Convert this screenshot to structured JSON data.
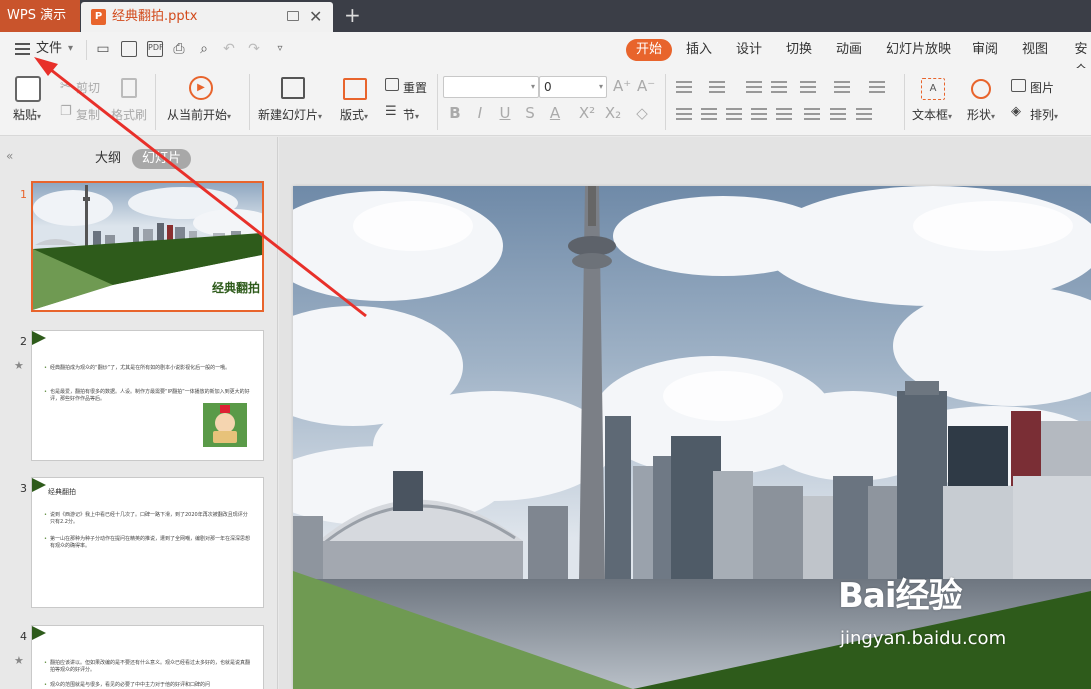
{
  "titlebar": {
    "app_label": "WPS 演示",
    "doc_tab": {
      "name": "经典翻拍.pptx",
      "icon": "P"
    },
    "new_tab_glyph": "+",
    "close_glyph": "✕"
  },
  "menubar": {
    "file_label": "文件",
    "tabs": [
      "开始",
      "插入",
      "设计",
      "切换",
      "动画",
      "幻灯片放映",
      "审阅",
      "视图",
      "安全"
    ],
    "active_tab": "开始"
  },
  "ribbon": {
    "paste": "粘贴",
    "cut": "剪切",
    "copy": "复制",
    "format_painter": "格式刷",
    "from_current": "从当前开始",
    "new_slide": "新建幻灯片",
    "layout": "版式",
    "reset": "重置",
    "section": "节",
    "font_size": "0",
    "textbox": "文本框",
    "shape": "形状",
    "picture": "图片",
    "arrange": "排列"
  },
  "leftpanel": {
    "tabs": [
      "大纲",
      "幻灯片"
    ],
    "active_tab": "幻灯片",
    "slides": [
      {
        "num": "1",
        "title": "经典翻拍"
      },
      {
        "num": "2",
        "bullets": [
          "经典翻拍成为观众的“翻炒”了，尤其是在所有如的剧本小说影视化后一般的一哦。",
          "也是最爱，翻拍有很多的数据。人设。制作方最需要“IP翻拍”一体播放的新加入到更大的好评，那些好作作品等后。"
        ]
      },
      {
        "num": "3",
        "head": "经典翻拍",
        "bullets": [
          "说到《西游记》我上中看已经十几次了。口碑一路下滑，到了2020年再次被翻改且现评分只有2.2分。",
          "第一山在那种为种子分动作在提问在精英的推说，遭到了全网嘲，编剧对那一年在深深思想有观众的确得率。"
        ]
      },
      {
        "num": "4",
        "bullets": [
          "翻拍应该讲以。但如果改编的是不要还有什么意义。观众已经看过太多好的，也就是说真翻拍等观众的好评分。",
          "观众的范围就是与很多，看见的必要了中中主力对于他的好评和口碑的问"
        ]
      }
    ]
  },
  "watermark": {
    "brand": "Bai经验",
    "url": "jingyan.baidu.com"
  },
  "colors": {
    "accent": "#e8642c",
    "green_light": "#6f9a52",
    "green_dark": "#2e5b1b"
  }
}
